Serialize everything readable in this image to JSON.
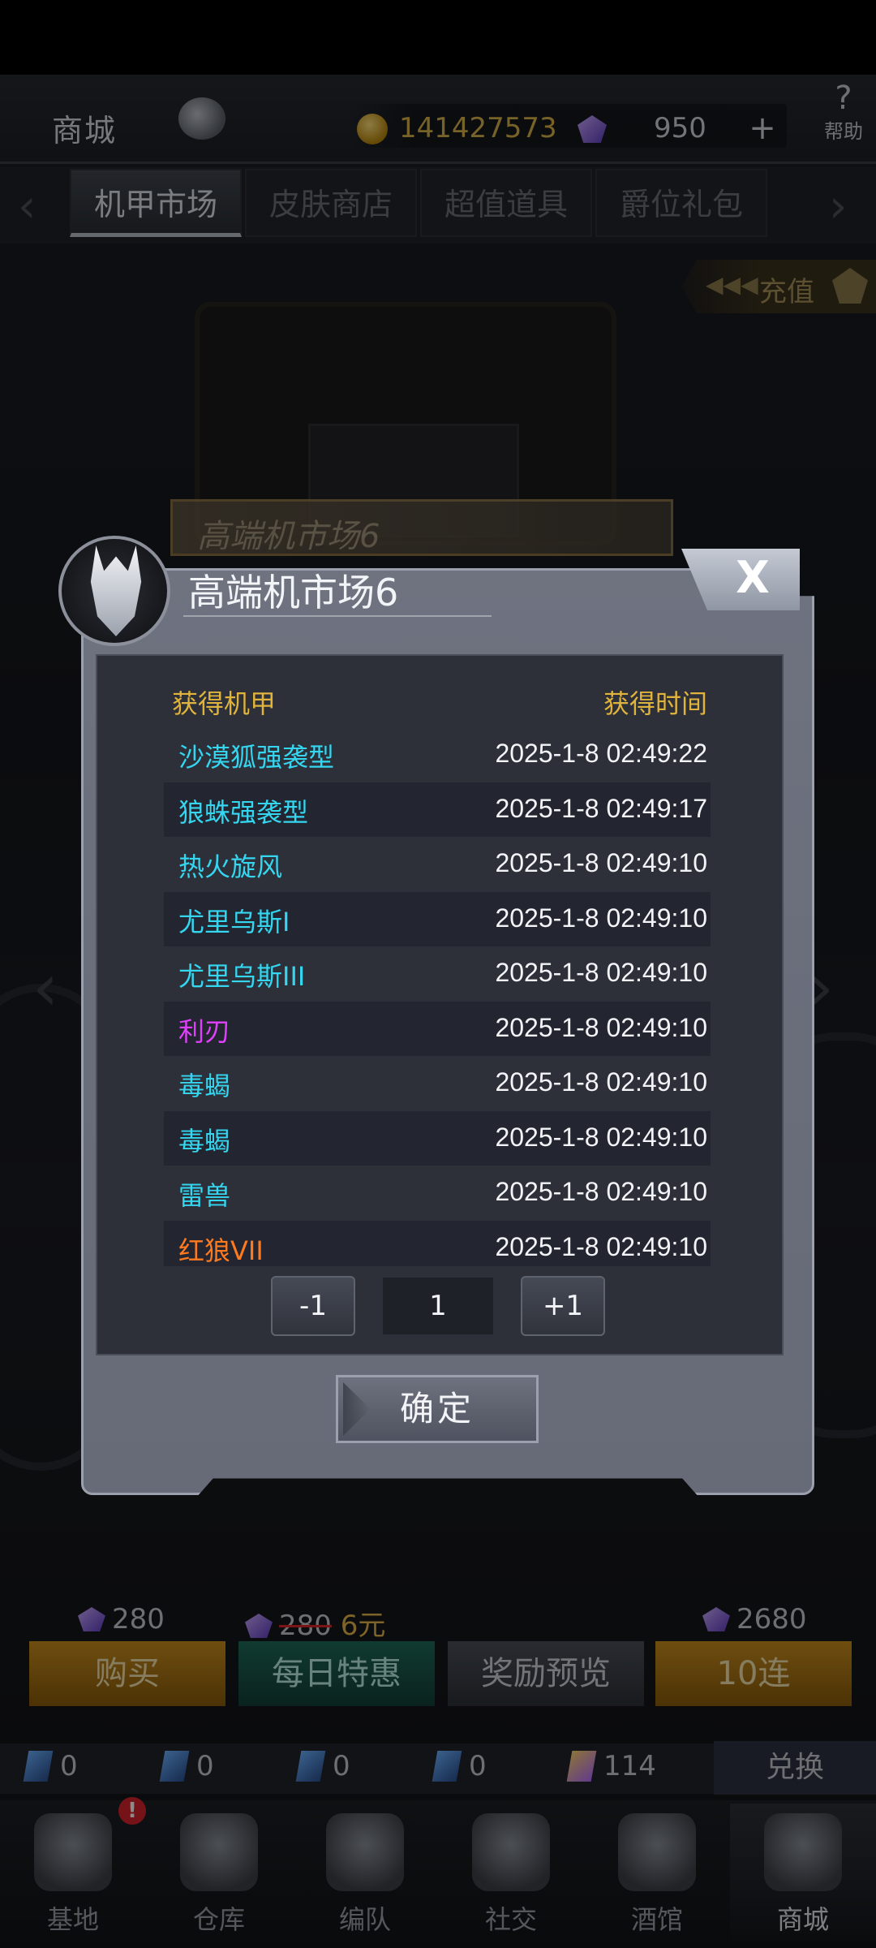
{
  "header": {
    "shop_title": "商城",
    "coins": "141427573",
    "gems": "950",
    "plus": "+",
    "help_label": "帮助",
    "help_symbol": "?"
  },
  "tabs": [
    {
      "label": "机甲市场",
      "active": true
    },
    {
      "label": "皮肤商店",
      "active": false
    },
    {
      "label": "超值道具",
      "active": false
    },
    {
      "label": "爵位礼包",
      "active": false
    }
  ],
  "recharge": {
    "label": "充值",
    "arrows": "◀◀◀"
  },
  "behind_banner": "高端机市场6",
  "modal": {
    "title": "高端机市场6",
    "close": "X",
    "col_mech": "获得机甲",
    "col_time": "获得时间",
    "rows": [
      {
        "name": "沙漠狐强袭型",
        "time": "2025-1-8 02:49:22",
        "color": "#34d6f0"
      },
      {
        "name": "狼蛛强袭型",
        "time": "2025-1-8 02:49:17",
        "color": "#34d6f0"
      },
      {
        "name": "热火旋风",
        "time": "2025-1-8 02:49:10",
        "color": "#34d6f0"
      },
      {
        "name": "尤里乌斯I",
        "time": "2025-1-8 02:49:10",
        "color": "#34d6f0"
      },
      {
        "name": "尤里乌斯III",
        "time": "2025-1-8 02:49:10",
        "color": "#34d6f0"
      },
      {
        "name": "利刃",
        "time": "2025-1-8 02:49:10",
        "color": "#e040fb"
      },
      {
        "name": "毒蝎",
        "time": "2025-1-8 02:49:10",
        "color": "#34d6f0"
      },
      {
        "name": "毒蝎",
        "time": "2025-1-8 02:49:10",
        "color": "#34d6f0"
      },
      {
        "name": "雷兽",
        "time": "2025-1-8 02:49:10",
        "color": "#34d6f0"
      },
      {
        "name": "红狼VII",
        "time": "2025-1-8 02:49:10",
        "color": "#ff7a1f"
      }
    ],
    "pager": {
      "minus": "-1",
      "value": "1",
      "plus": "+1"
    },
    "confirm": "确定"
  },
  "purchase": {
    "price_single": "280",
    "price_daily_old": "280",
    "price_daily_new": "6元",
    "price_ten": "2680",
    "btn_buy": "购买",
    "btn_daily": "每日特惠",
    "btn_preview": "奖励预览",
    "btn_ten": "10连"
  },
  "resources": {
    "items": [
      "0",
      "0",
      "0",
      "0"
    ],
    "crystal": "114",
    "exchange": "兑换"
  },
  "nav": {
    "badge": "!",
    "items": [
      {
        "label": "基地"
      },
      {
        "label": "仓库"
      },
      {
        "label": "编队"
      },
      {
        "label": "社交"
      },
      {
        "label": "酒馆"
      },
      {
        "label": "商城"
      }
    ]
  }
}
